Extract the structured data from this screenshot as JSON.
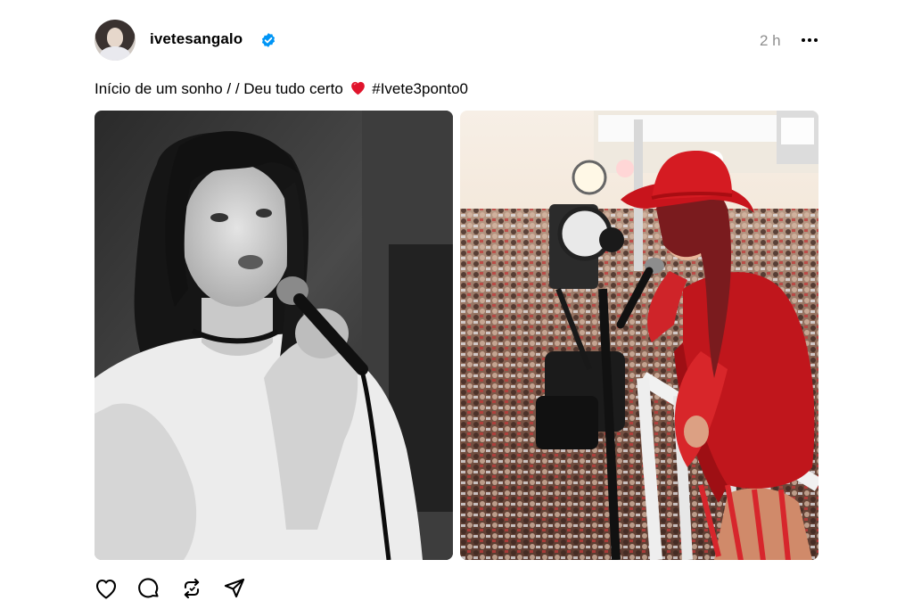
{
  "post": {
    "author": {
      "username": "ivetesangalo",
      "verified": true,
      "avatar_icon": "profile-photo",
      "verified_color": "#0095f6"
    },
    "time": "2 h",
    "more_icon": "more-horizontal-icon",
    "caption": {
      "text": "Início de um sonho / / Deu tudo certo",
      "emoji": "❤️",
      "hashtag": "#Ivete3ponto0"
    },
    "media": [
      {
        "kind": "photo",
        "description_icon": "black-and-white-singer-photo"
      },
      {
        "kind": "photo",
        "description_icon": "carnival-stage-singer-photo"
      }
    ],
    "actions": [
      {
        "name": "like",
        "icon": "heart-icon"
      },
      {
        "name": "reply",
        "icon": "comment-icon"
      },
      {
        "name": "repost",
        "icon": "repost-icon"
      },
      {
        "name": "share",
        "icon": "send-icon"
      }
    ]
  }
}
